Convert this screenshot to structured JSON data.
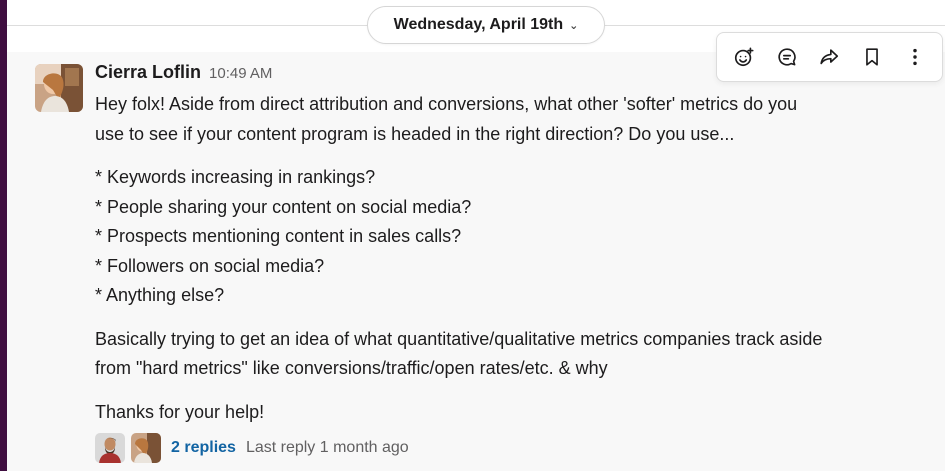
{
  "date_divider": {
    "label": "Wednesday, April 19th",
    "chevron": "▾"
  },
  "message": {
    "author": "Cierra Loflin",
    "time": "10:49 AM",
    "intro_lines": [
      "Hey folx! Aside from direct attribution and conversions, what other 'softer' metrics do you",
      "use to see if your content program is headed in the right direction? Do you use..."
    ],
    "bullets": [
      "* Keywords increasing in rankings?",
      "* People sharing your content on social media?",
      "* Prospects mentioning content in sales calls?",
      "* Followers on social media?",
      "* Anything else?"
    ],
    "outro_lines": [
      "Basically trying to get an idea of what quantitative/qualitative metrics companies track aside",
      "from \"hard metrics\" like conversions/traffic/open rates/etc. & why"
    ],
    "closing": "Thanks for your help!"
  },
  "thread": {
    "replies_label": "2 replies",
    "last_reply": "Last reply 1 month ago"
  },
  "toolbar_icons": [
    "add-reaction-icon",
    "reply-in-thread-icon",
    "share-icon",
    "save-bookmark-icon",
    "more-actions-icon"
  ],
  "colors": {
    "sidebar": "#3f0e40",
    "link": "#1264a3",
    "text": "#1d1c1d",
    "muted": "#616061"
  }
}
